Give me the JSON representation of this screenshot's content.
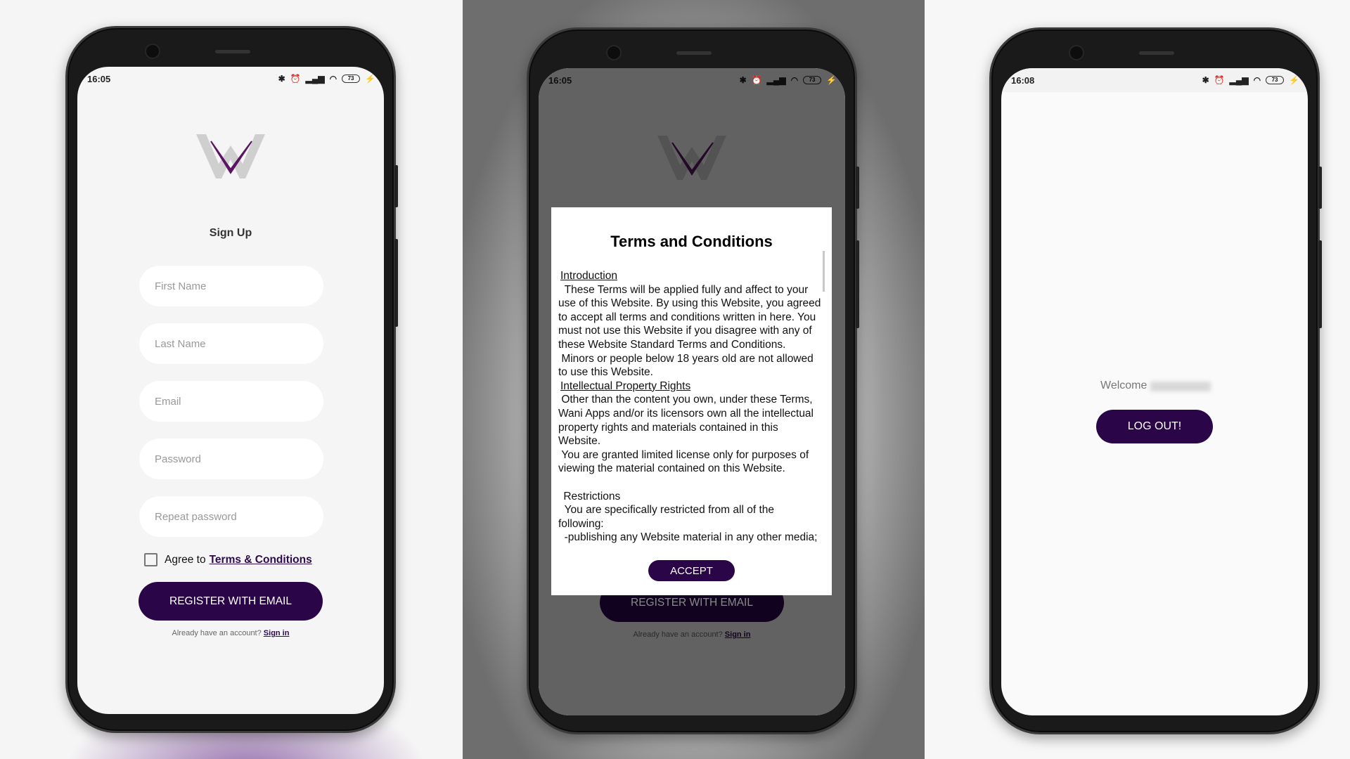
{
  "colors": {
    "accent": "#2a0547",
    "link": "#2c0a4c",
    "battery": "#5ad12a"
  },
  "screens": [
    {
      "status": {
        "time": "16:05",
        "battery": "73"
      },
      "title": "Sign Up",
      "fields": [
        {
          "placeholder": "First Name",
          "value": ""
        },
        {
          "placeholder": "Last Name",
          "value": ""
        },
        {
          "placeholder": "Email",
          "value": ""
        },
        {
          "placeholder": "Password",
          "value": ""
        },
        {
          "placeholder": "Repeat password",
          "value": ""
        }
      ],
      "agree_text": "Agree to",
      "agree_link": "Terms & Conditions",
      "agree_checked": false,
      "register_label": "REGISTER WITH EMAIL",
      "already_text": "Already have an account?",
      "sign_in": "Sign in"
    },
    {
      "status": {
        "time": "16:05",
        "battery": "73"
      },
      "register_label": "REGISTER WITH EMAIL",
      "already_text": "Already have an account?",
      "sign_in": "Sign in",
      "modal": {
        "title": "Terms and Conditions",
        "sections": [
          {
            "heading": "Introduction",
            "body": "  These Terms will be applied fully and affect to your use of this Website. By using this Website, you agreed to accept all terms and conditions written in here. You must not use this Website if you disagree with any of these Website Standard Terms and Conditions.\n Minors or people below 18 years old are not allowed to use this Website."
          },
          {
            "heading": "Intellectual Property Rights",
            "body": " Other than the content you own, under these Terms, Wani Apps and/or its licensors own all the intellectual property rights and materials contained in this Website.\n You are granted limited license only for purposes of viewing the material contained on this Website.\n"
          },
          {
            "heading": "Restrictions",
            "body": "  You are specifically restricted from all of the following:\n  -publishing any Website material in any other media;"
          }
        ],
        "accept_label": "ACCEPT"
      }
    },
    {
      "status": {
        "time": "16:08",
        "battery": "73"
      },
      "welcome": "Welcome",
      "logout_label": "LOG OUT!"
    }
  ]
}
